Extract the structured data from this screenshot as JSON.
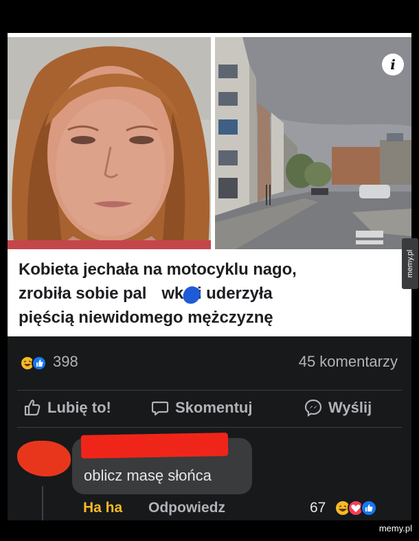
{
  "post": {
    "preview": {
      "info_icon": "info-icon",
      "info_glyph": "i"
    },
    "headline_lines": [
      "Kobieta jechała na motocyklu nago,",
      "zrobiła sobie pal",
      "wkę i uderzyła",
      "pięścią niewidomego mężczyznę"
    ],
    "reactions": {
      "icons": [
        "haha-reaction-icon",
        "like-reaction-icon"
      ],
      "count": "398",
      "comments": "45 komentarzy"
    },
    "actions": [
      {
        "label": "Lubię to!",
        "icon": "thumbs-up-icon"
      },
      {
        "label": "Skomentuj",
        "icon": "comment-bubble-icon"
      },
      {
        "label": "Wyślij",
        "icon": "messenger-icon"
      }
    ],
    "comment": {
      "text": "oblicz masę słońca",
      "haha_label": "Ha ha",
      "reply_label": "Odpowiedz",
      "reaction_count": "67",
      "reaction_icons": [
        "haha-reaction-icon",
        "love-reaction-icon",
        "like-reaction-icon"
      ]
    }
  },
  "watermarks": {
    "side": "memy.pl",
    "corner": "memy.pl"
  },
  "colors": {
    "background": "#18191a",
    "text_secondary": "#b0b3b8",
    "haha_yellow": "#f7b928",
    "like_blue": "#1877f2",
    "love_red": "#f33e58",
    "redaction_red": "#f0251a"
  }
}
